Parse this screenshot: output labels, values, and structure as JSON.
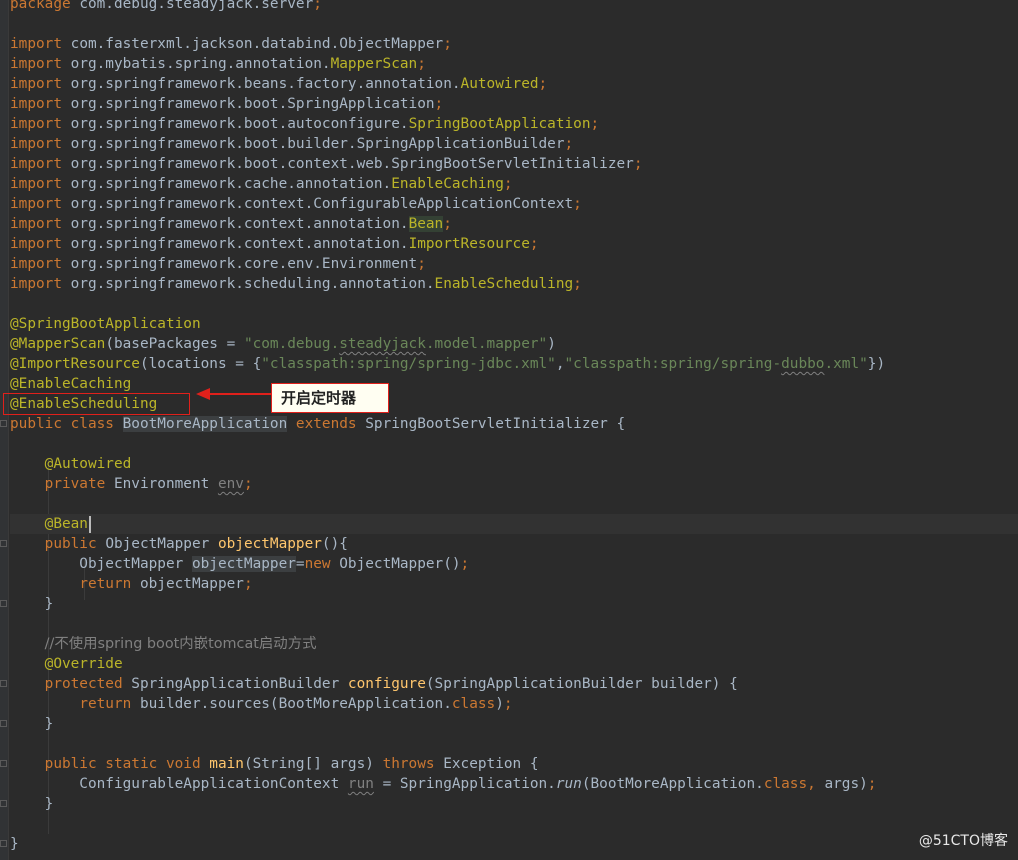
{
  "editor": {
    "lines": [
      {
        "tokens": [
          {
            "t": "package ",
            "c": "kw"
          },
          {
            "t": "com.debug.steadyjack.server"
          },
          {
            "t": ";",
            "c": "kw"
          }
        ]
      },
      {
        "tokens": []
      },
      {
        "tokens": [
          {
            "t": "import ",
            "c": "kw"
          },
          {
            "t": "com.fasterxml.jackson.databind.ObjectMapper"
          },
          {
            "t": ";",
            "c": "kw"
          }
        ]
      },
      {
        "tokens": [
          {
            "t": "import ",
            "c": "kw"
          },
          {
            "t": "org.mybatis.spring.annotation."
          },
          {
            "t": "MapperScan",
            "c": "an"
          },
          {
            "t": ";",
            "c": "kw"
          }
        ]
      },
      {
        "tokens": [
          {
            "t": "import ",
            "c": "kw"
          },
          {
            "t": "org.springframework.beans.factory.annotation."
          },
          {
            "t": "Autowired",
            "c": "an"
          },
          {
            "t": ";",
            "c": "kw"
          }
        ]
      },
      {
        "tokens": [
          {
            "t": "import ",
            "c": "kw"
          },
          {
            "t": "org.springframework.boot.SpringApplication"
          },
          {
            "t": ";",
            "c": "kw"
          }
        ]
      },
      {
        "tokens": [
          {
            "t": "import ",
            "c": "kw"
          },
          {
            "t": "org.springframework.boot.autoconfigure."
          },
          {
            "t": "SpringBootApplication",
            "c": "an"
          },
          {
            "t": ";",
            "c": "kw"
          }
        ]
      },
      {
        "tokens": [
          {
            "t": "import ",
            "c": "kw"
          },
          {
            "t": "org.springframework.boot.builder.SpringApplicationBuilder"
          },
          {
            "t": ";",
            "c": "kw"
          }
        ]
      },
      {
        "tokens": [
          {
            "t": "import ",
            "c": "kw"
          },
          {
            "t": "org.springframework.boot.context.web.SpringBootServletInitializer"
          },
          {
            "t": ";",
            "c": "kw"
          }
        ]
      },
      {
        "tokens": [
          {
            "t": "import ",
            "c": "kw"
          },
          {
            "t": "org.springframework.cache.annotation."
          },
          {
            "t": "EnableCaching",
            "c": "an"
          },
          {
            "t": ";",
            "c": "kw"
          }
        ]
      },
      {
        "tokens": [
          {
            "t": "import ",
            "c": "kw"
          },
          {
            "t": "org.springframework.context.ConfigurableApplicationContext"
          },
          {
            "t": ";",
            "c": "kw"
          }
        ]
      },
      {
        "tokens": [
          {
            "t": "import ",
            "c": "kw"
          },
          {
            "t": "org.springframework.context.annotation."
          },
          {
            "t": "Bean",
            "c": "an hl2"
          },
          {
            "t": ";",
            "c": "kw"
          }
        ]
      },
      {
        "tokens": [
          {
            "t": "import ",
            "c": "kw"
          },
          {
            "t": "org.springframework.context.annotation."
          },
          {
            "t": "ImportResource",
            "c": "an"
          },
          {
            "t": ";",
            "c": "kw"
          }
        ]
      },
      {
        "tokens": [
          {
            "t": "import ",
            "c": "kw"
          },
          {
            "t": "org.springframework.core.env.Environment"
          },
          {
            "t": ";",
            "c": "kw"
          }
        ]
      },
      {
        "tokens": [
          {
            "t": "import ",
            "c": "kw"
          },
          {
            "t": "org.springframework.scheduling.annotation."
          },
          {
            "t": "EnableScheduling",
            "c": "an"
          },
          {
            "t": ";",
            "c": "kw"
          }
        ]
      },
      {
        "tokens": []
      },
      {
        "tokens": [
          {
            "t": "@SpringBootApplication",
            "c": "an"
          }
        ]
      },
      {
        "tokens": [
          {
            "t": "@MapperScan",
            "c": "an"
          },
          {
            "t": "(basePackages = "
          },
          {
            "t": "\"com.debug.",
            "c": "st"
          },
          {
            "t": "steadyjack",
            "c": "st ul-warn"
          },
          {
            "t": ".model.mapper\"",
            "c": "st"
          },
          {
            "t": ")"
          }
        ]
      },
      {
        "tokens": [
          {
            "t": "@ImportResource",
            "c": "an"
          },
          {
            "t": "(locations = {"
          },
          {
            "t": "\"classpath:spring/spring-jdbc.xml\"",
            "c": "st"
          },
          {
            "t": ","
          },
          {
            "t": "\"classpath:spring/spring-",
            "c": "st"
          },
          {
            "t": "dubbo",
            "c": "st ul-warn"
          },
          {
            "t": ".xml\"",
            "c": "st"
          },
          {
            "t": "})"
          }
        ]
      },
      {
        "tokens": [
          {
            "t": "@EnableCaching",
            "c": "an"
          }
        ]
      },
      {
        "tokens": [
          {
            "t": "@EnableScheduling",
            "c": "an"
          }
        ]
      },
      {
        "tokens": [
          {
            "t": "public class ",
            "c": "kw"
          },
          {
            "t": "BootMoreApplication",
            "c": "hl"
          },
          {
            "t": " extends ",
            "c": "kw"
          },
          {
            "t": "SpringBootServletInitializer {"
          }
        ]
      },
      {
        "tokens": []
      },
      {
        "tokens": [
          {
            "t": "    "
          },
          {
            "t": "@Autowired",
            "c": "an"
          }
        ]
      },
      {
        "tokens": [
          {
            "t": "    "
          },
          {
            "t": "private ",
            "c": "kw"
          },
          {
            "t": "Environment "
          },
          {
            "t": "env",
            "c": "cm ul-warn"
          },
          {
            "t": ";",
            "c": "kw"
          }
        ]
      },
      {
        "tokens": []
      },
      {
        "caret": true,
        "tokens": [
          {
            "t": "    "
          },
          {
            "t": "@Bean",
            "c": "an"
          }
        ]
      },
      {
        "tokens": [
          {
            "t": "    "
          },
          {
            "t": "public ",
            "c": "kw"
          },
          {
            "t": "ObjectMapper "
          },
          {
            "t": "objectMapper",
            "c": "fn"
          },
          {
            "t": "(){"
          }
        ]
      },
      {
        "tokens": [
          {
            "t": "        ObjectMapper "
          },
          {
            "t": "objectMapper",
            "c": "hl"
          },
          {
            "t": "="
          },
          {
            "t": "new ",
            "c": "kw"
          },
          {
            "t": "ObjectMapper()"
          },
          {
            "t": ";",
            "c": "kw"
          }
        ]
      },
      {
        "tokens": [
          {
            "t": "        "
          },
          {
            "t": "return ",
            "c": "kw"
          },
          {
            "t": "objectMapper"
          },
          {
            "t": ";",
            "c": "kw"
          }
        ]
      },
      {
        "tokens": [
          {
            "t": "    }"
          }
        ]
      },
      {
        "tokens": []
      },
      {
        "tokens": [
          {
            "t": "    "
          },
          {
            "t": "//不使用spring boot内嵌tomcat启动方式",
            "c": "cm"
          }
        ]
      },
      {
        "tokens": [
          {
            "t": "    "
          },
          {
            "t": "@Override",
            "c": "an"
          }
        ]
      },
      {
        "tokens": [
          {
            "t": "    "
          },
          {
            "t": "protected ",
            "c": "kw"
          },
          {
            "t": "SpringApplicationBuilder "
          },
          {
            "t": "configure",
            "c": "fn"
          },
          {
            "t": "(SpringApplicationBuilder builder) {"
          }
        ]
      },
      {
        "tokens": [
          {
            "t": "        "
          },
          {
            "t": "return ",
            "c": "kw"
          },
          {
            "t": "builder.sources(BootMoreApplication."
          },
          {
            "t": "class",
            "c": "kw"
          },
          {
            "t": ")"
          },
          {
            "t": ";",
            "c": "kw"
          }
        ]
      },
      {
        "tokens": [
          {
            "t": "    }"
          }
        ]
      },
      {
        "tokens": []
      },
      {
        "tokens": [
          {
            "t": "    "
          },
          {
            "t": "public static void ",
            "c": "kw"
          },
          {
            "t": "main",
            "c": "fn"
          },
          {
            "t": "(String[] args) "
          },
          {
            "t": "throws ",
            "c": "kw"
          },
          {
            "t": "Exception {"
          }
        ]
      },
      {
        "tokens": [
          {
            "t": "        ConfigurableApplicationContext "
          },
          {
            "t": "run",
            "c": "cm ul-warn"
          },
          {
            "t": " = SpringApplication."
          },
          {
            "t": "run",
            "c": "it"
          },
          {
            "t": "(BootMoreApplication."
          },
          {
            "t": "class",
            "c": "kw"
          },
          {
            "t": ", ",
            "c": "kw"
          },
          {
            "t": "args)"
          },
          {
            "t": ";",
            "c": "kw"
          }
        ]
      },
      {
        "tokens": [
          {
            "t": "    }"
          }
        ]
      },
      {
        "tokens": []
      },
      {
        "tokens": [
          {
            "t": "}"
          }
        ]
      }
    ]
  },
  "annotation": {
    "label": "开启定时器"
  },
  "watermark": "@51CTO博客",
  "colors": {
    "background": "#2b2b2b",
    "keyword": "#cc7832",
    "annotation": "#bbb529",
    "string": "#6a8759",
    "comment": "#808080",
    "method": "#ffc66d",
    "highlight_box": "#e0201b"
  }
}
